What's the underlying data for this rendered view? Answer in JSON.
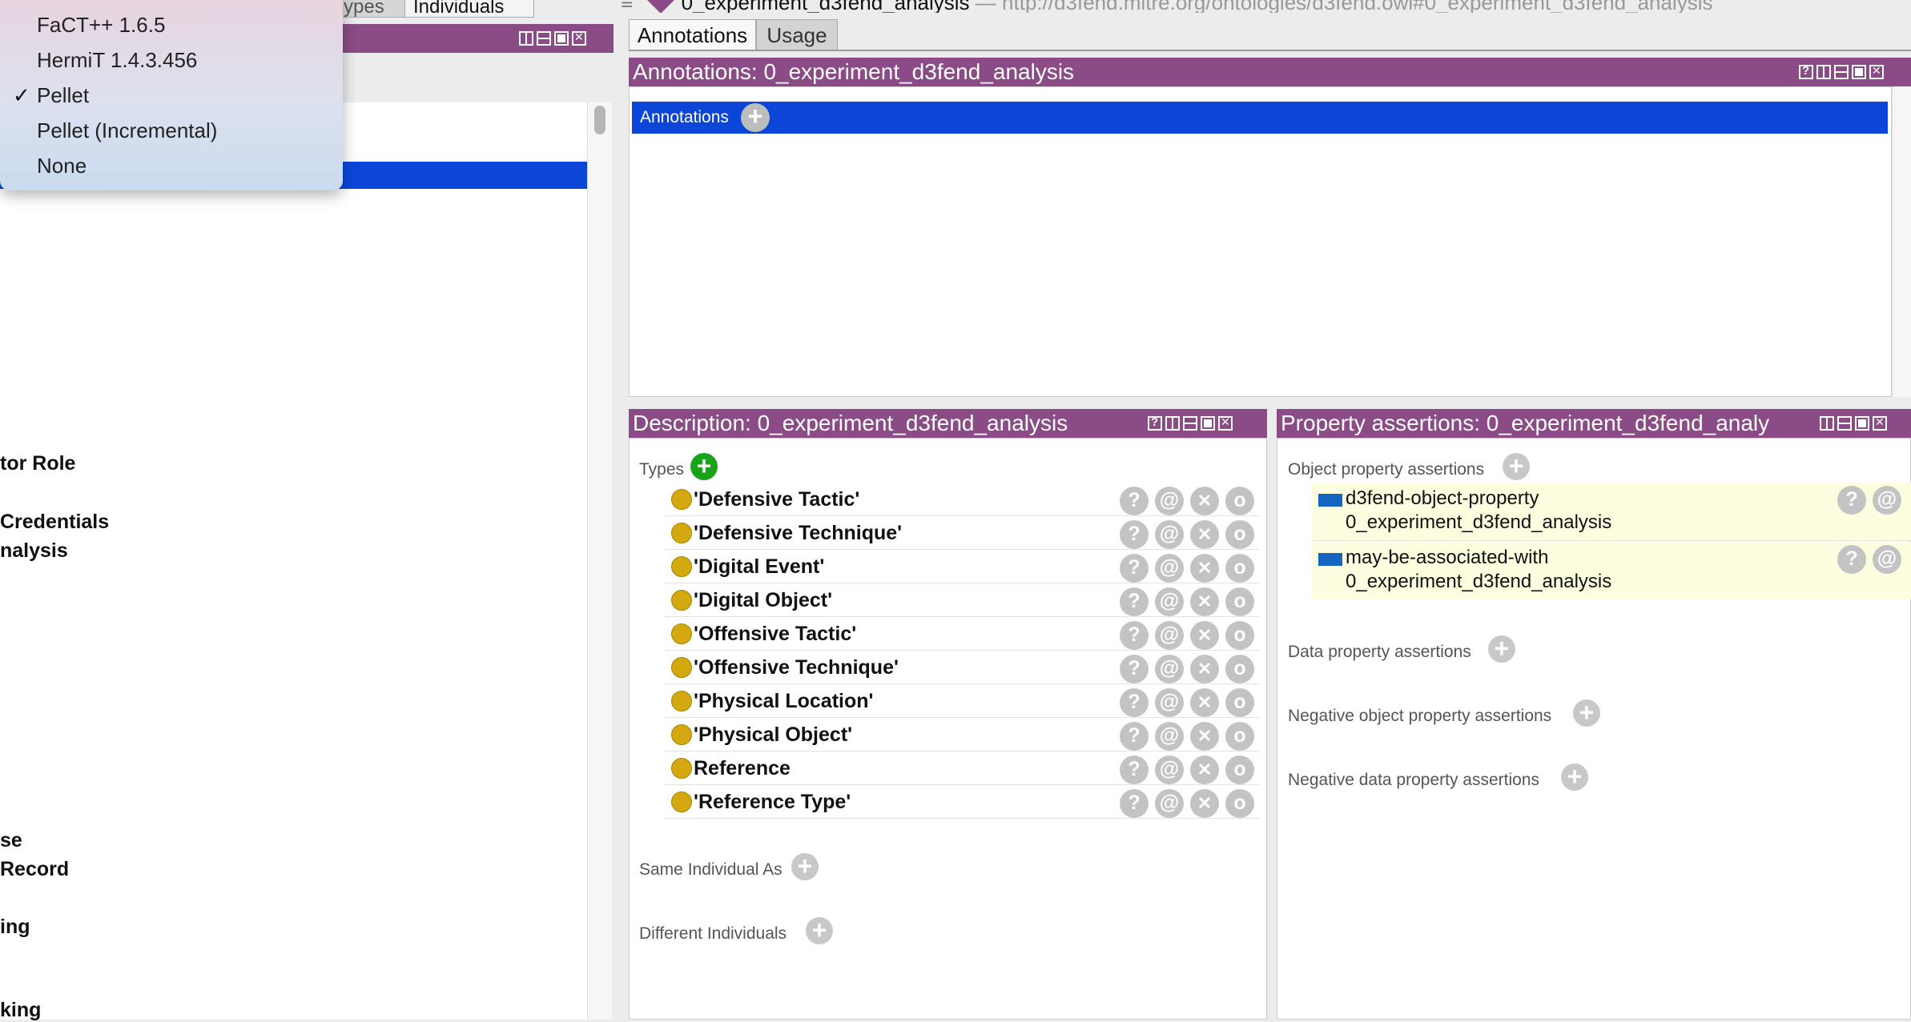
{
  "reasoner_menu": {
    "items": [
      {
        "label": "FaCT++ 1.6.5",
        "checked": false
      },
      {
        "label": "HermiT 1.4.3.456",
        "checked": false
      },
      {
        "label": "Pellet",
        "checked": true
      },
      {
        "label": "Pellet (Incremental)",
        "checked": false
      },
      {
        "label": "None",
        "checked": false
      }
    ],
    "check_glyph": "✓"
  },
  "left_tabs": {
    "tab1": "ypes",
    "tab2": "Individuals"
  },
  "left_list": [
    "tor Role",
    "Credentials",
    "nalysis",
    "se",
    "Record",
    "ing",
    "king"
  ],
  "entity_header": {
    "name": "0_experiment_d3fend_analysis",
    "separator": "—",
    "iri": "http://d3fend.mitre.org/ontologies/d3fend.owl#0_experiment_d3fend_analysis"
  },
  "top_tabs": [
    "Annotations",
    "Usage"
  ],
  "annotations_panel": {
    "title": "Annotations: 0_experiment_d3fend_analysis",
    "row_label": "Annotations"
  },
  "description_panel": {
    "title": "Description: 0_experiment_d3fend_analysis",
    "types_label": "Types",
    "types": [
      "'Defensive Tactic'",
      "'Defensive Technique'",
      "'Digital Event'",
      "'Digital Object'",
      "'Offensive Tactic'",
      "'Offensive Technique'",
      "'Physical Location'",
      "'Physical Object'",
      "Reference",
      "'Reference Type'"
    ],
    "same_individual_label": "Same Individual As",
    "different_individuals_label": "Different Individuals"
  },
  "row_buttons": {
    "help": "?",
    "annotate": "@",
    "delete": "✕",
    "edit": "o"
  },
  "property_panel": {
    "title": "Property assertions: 0_experiment_d3fend_analy",
    "object_label": "Object property assertions",
    "assertions": [
      {
        "property": "d3fend-object-property",
        "value": "0_experiment_d3fend_analysis"
      },
      {
        "property": "may-be-associated-with",
        "value": "0_experiment_d3fend_analysis"
      }
    ],
    "data_label": "Data property assertions",
    "neg_object_label": "Negative object property assertions",
    "neg_data_label": "Negative data property assertions"
  },
  "colors": {
    "header_purple": "#8a4b86",
    "selection_blue": "#0b46d9",
    "type_dot": "#d4a90f",
    "assertion_bg": "#fdfde0",
    "property_icon": "#1565c0",
    "add_green": "#19a319"
  },
  "icons": {
    "plus": "+",
    "hamburger": "≡"
  }
}
